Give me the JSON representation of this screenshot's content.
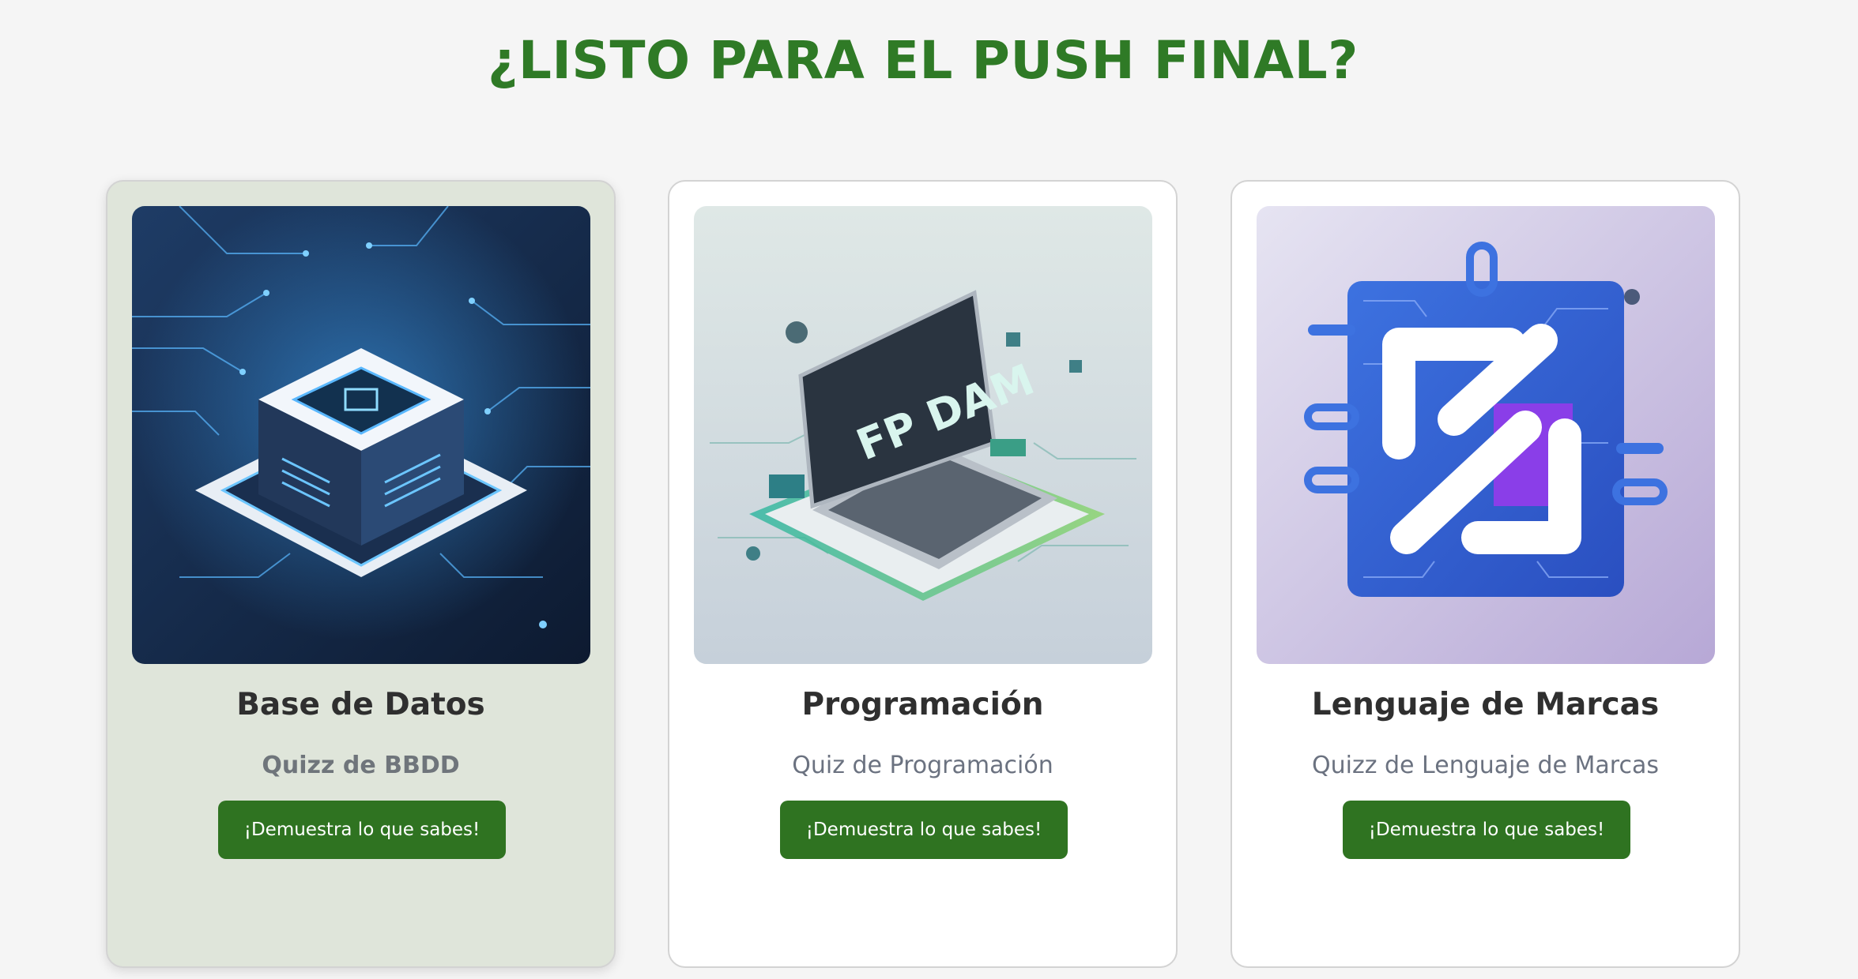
{
  "page": {
    "title": "¿LISTO PARA EL PUSH FINAL?"
  },
  "colors": {
    "title": "#2f7a26",
    "button": "#2f7321",
    "highlighted_card": "#dfe5da"
  },
  "cards": [
    {
      "title": "Base de Datos",
      "subtitle": "Quizz de BBDD",
      "button_label": "¡Demuestra lo que sabes!",
      "image_icon": "database-server-icon",
      "highlighted": true
    },
    {
      "title": "Programación",
      "subtitle": "Quiz de Programación",
      "button_label": "¡Demuestra lo que sabes!",
      "image_icon": "laptop-icon",
      "image_text": "FP DAM",
      "highlighted": false
    },
    {
      "title": "Lenguaje de Marcas",
      "subtitle": "Quizz de Lenguaje de Marcas",
      "button_label": "¡Demuestra lo que sabes!",
      "image_icon": "circuit-markup-icon",
      "highlighted": false
    }
  ]
}
